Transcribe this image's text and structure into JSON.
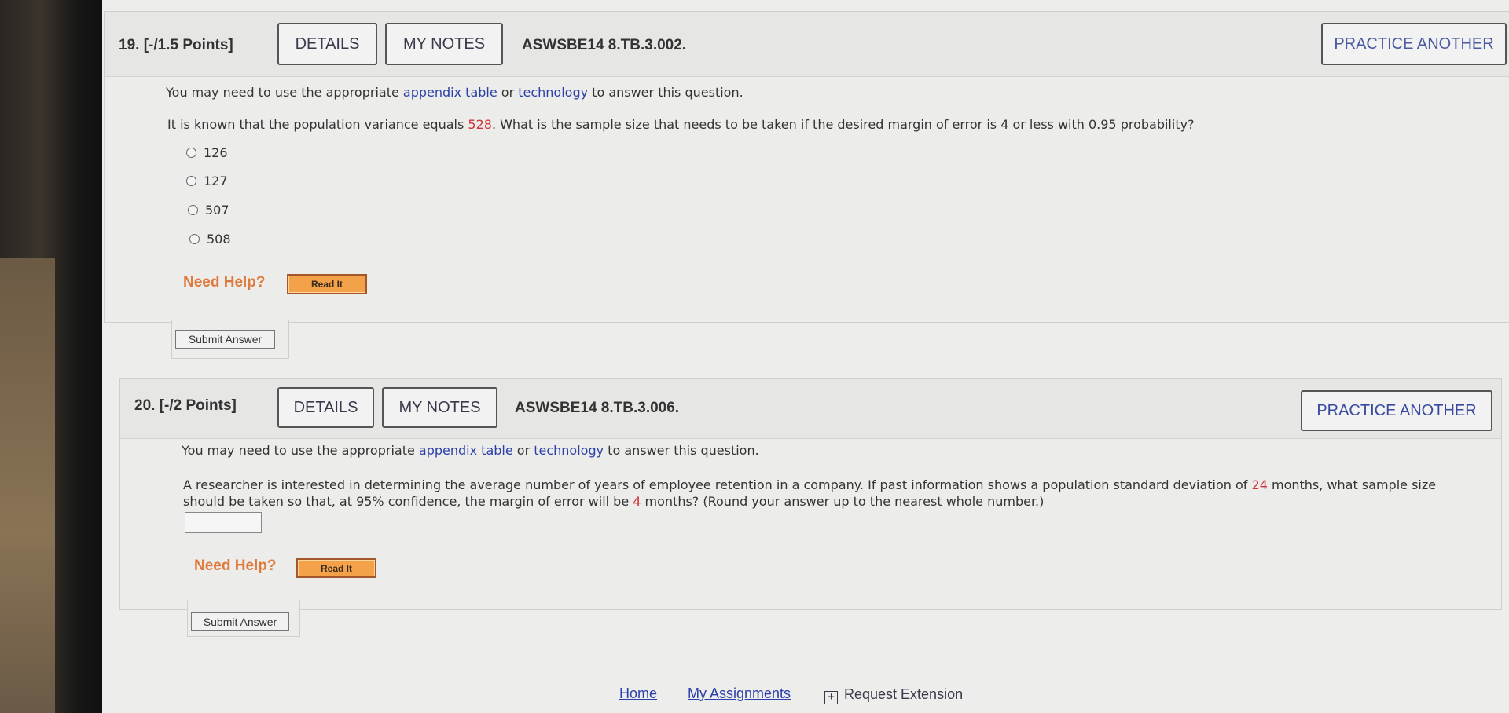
{
  "questions": [
    {
      "number": "19.",
      "points": "[-/1.5 Points]",
      "details_label": "DETAILS",
      "notes_label": "MY NOTES",
      "code": "ASWSBE14 8.TB.3.002.",
      "practice_label": "PRACTICE ANOTHER",
      "intro_prefix": "You may need to use the appropriate ",
      "intro_link1": "appendix table",
      "intro_mid": " or ",
      "intro_link2": "technology",
      "intro_suffix": " to answer this question.",
      "text_prefix": "It is known that the population variance equals ",
      "text_value": "528",
      "text_suffix": ". What is the sample size that needs to be taken if the desired margin of error is 4 or less with 0.95 probability?",
      "choices": [
        "126",
        "127",
        "507",
        "508"
      ],
      "need_help": "Need Help?",
      "read_it": "Read It",
      "submit": "Submit Answer"
    },
    {
      "number": "20.",
      "points": "[-/2 Points]",
      "details_label": "DETAILS",
      "notes_label": "MY NOTES",
      "code": "ASWSBE14 8.TB.3.006.",
      "practice_label": "PRACTICE ANOTHER",
      "intro_prefix": "You may need to use the appropriate ",
      "intro_link1": "appendix table",
      "intro_mid": " or ",
      "intro_link2": "technology",
      "intro_suffix": " to answer this question.",
      "text_line1_prefix": "A researcher is interested in determining the average number of years of employee retention in a company. If past information shows a population standard deviation of ",
      "text_value1": "24",
      "text_line1_suffix": " months, what sample size",
      "text_line2_prefix": "should be taken so that, at 95% confidence, the margin of error will be ",
      "text_value2": "4",
      "text_line2_suffix": " months? (Round your answer up to the nearest whole number.)",
      "answer_value": "",
      "need_help": "Need Help?",
      "read_it": "Read It",
      "submit": "Submit Answer"
    }
  ],
  "footer": {
    "home": "Home",
    "assignments": "My Assignments",
    "extension": "Request Extension"
  }
}
